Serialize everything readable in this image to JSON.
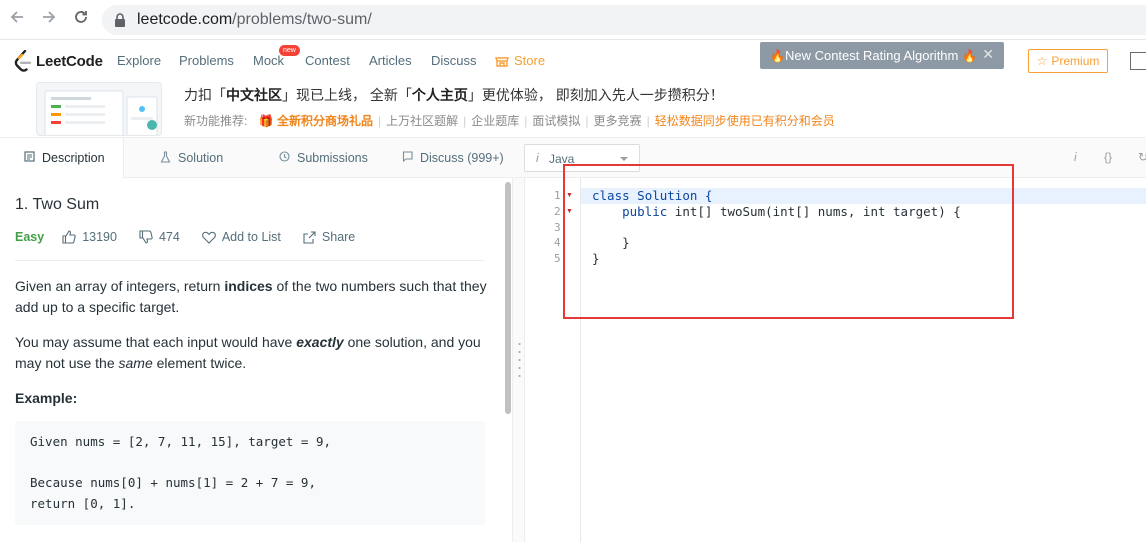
{
  "browser": {
    "url_domain": "leetcode.com",
    "url_path": "/problems/two-sum/"
  },
  "nav": {
    "logo": "LeetCode",
    "items": [
      "Explore",
      "Problems",
      "Mock",
      "Contest",
      "Articles",
      "Discuss",
      "Store"
    ],
    "new_badge": "new",
    "contest_banner": "New Contest Rating Algorithm",
    "premium": "Premium"
  },
  "cn_banner": {
    "title_1": "力扣「",
    "title_b1": "中文社区",
    "title_2": "」现已上线， 全新「",
    "title_b2": "个人主页",
    "title_3": "」更优体验， 即刻加入先人一步攒积分！",
    "links_label": "新功能推荐:",
    "link_highlight": "全新积分商场礼品",
    "links": [
      "上万社区题解",
      "企业题库",
      "面试模拟",
      "更多竞赛"
    ],
    "link_orange": "轻松数据同步使用已有积分和会员"
  },
  "tabs": {
    "description": "Description",
    "solution": "Solution",
    "submissions": "Submissions",
    "discuss": "Discuss (999+)",
    "language": "Java"
  },
  "problem": {
    "title": "1. Two Sum",
    "difficulty": "Easy",
    "likes": "13190",
    "dislikes": "474",
    "add_to_list": "Add to List",
    "share": "Share",
    "p1_a": "Given an array of integers, return ",
    "p1_b": "indices",
    "p1_c": " of the two numbers such that they add up to a specific target.",
    "p2_a": "You may assume that each input would have ",
    "p2_b": "exactly",
    "p2_c": " one solution, and you may not use the ",
    "p2_d": "same",
    "p2_e": " element twice.",
    "example_title": "Example:",
    "example_lines": [
      "Given nums = [2, 7, 11, 15], target = 9,",
      "Because nums[0] + nums[1] = 2 + 7 = 9,",
      "return [0, 1]."
    ]
  },
  "editor": {
    "line_numbers": [
      "1",
      "2",
      "3",
      "4",
      "5"
    ],
    "l1_kw": "class",
    "l1_name": " Solution {",
    "l2_kw": "    public",
    "l2_rest": " int[] twoSum(int[] nums, int target) {",
    "l4": "    }",
    "l5": "}"
  },
  "colors": {
    "brand_orange": "#f8a036",
    "easy_green": "#43a047",
    "highlight_red": "#e53935"
  }
}
